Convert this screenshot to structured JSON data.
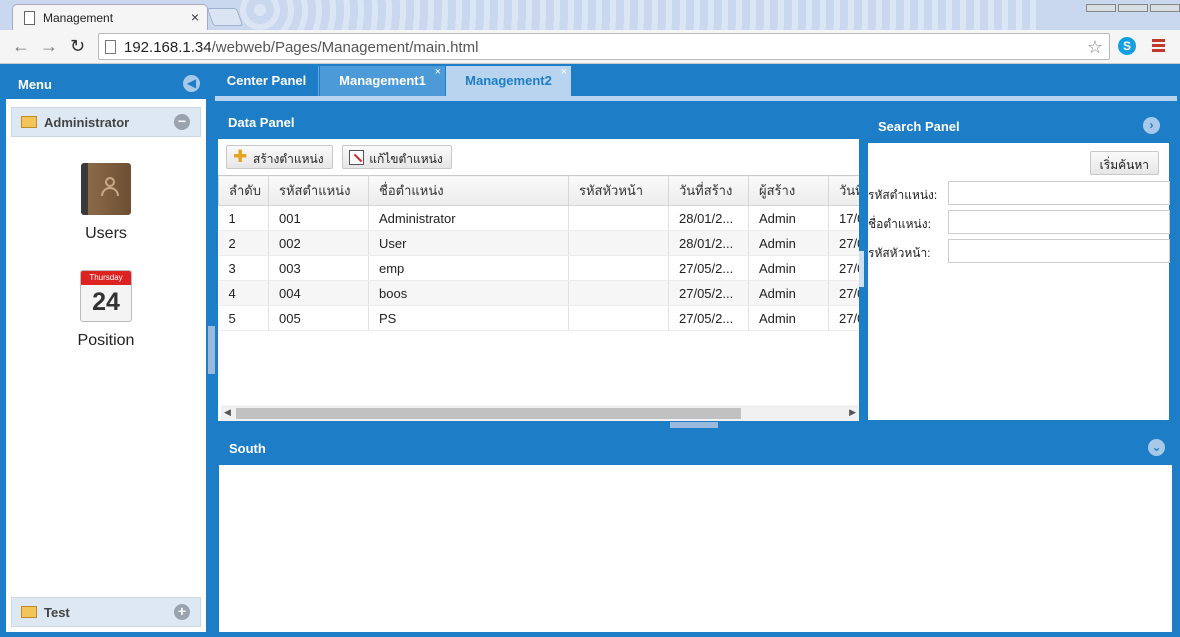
{
  "browser": {
    "tab_title": "Management",
    "tab_close": "×",
    "url_host": "192.168.1.34",
    "url_path": "/webweb/Pages/Management/main.html",
    "skype_letter": "S"
  },
  "west": {
    "title": "Menu",
    "collapse_glyph": "◀",
    "group_admin": {
      "label": "Administrator",
      "toggle": "−"
    },
    "group_test": {
      "label": "Test",
      "toggle": "+"
    },
    "apps": [
      {
        "label": "Users"
      },
      {
        "label": "Position",
        "cal_day_name": "Thursday",
        "cal_day": "24"
      }
    ]
  },
  "tabs": [
    {
      "label": "Center Panel",
      "close": ""
    },
    {
      "label": "Management1",
      "close": "×"
    },
    {
      "label": "Management2",
      "close": "×"
    }
  ],
  "data_panel": {
    "title": "Data Panel",
    "create_button": "สร้างตำแหน่ง",
    "edit_button": "แก้ไขตำแหน่ง",
    "columns": [
      "ลำดับ",
      "รหัสตำแหน่ง",
      "ชื่อตำแหน่ง",
      "รหัสหัวหน้า",
      "วันที่สร้าง",
      "ผู้สร้าง",
      "วันที่"
    ],
    "rows": [
      [
        "1",
        "001",
        "Administrator",
        "",
        "28/01/2...",
        "Admin",
        "17/0"
      ],
      [
        "2",
        "002",
        "User",
        "",
        "28/01/2...",
        "Admin",
        "27/0"
      ],
      [
        "3",
        "003",
        "emp",
        "",
        "27/05/2...",
        "Admin",
        "27/0"
      ],
      [
        "4",
        "004",
        "boos",
        "",
        "27/05/2...",
        "Admin",
        "27/0"
      ],
      [
        "5",
        "005",
        "PS",
        "",
        "27/05/2...",
        "Admin",
        "27/0"
      ]
    ],
    "selected_row": 1
  },
  "search_panel": {
    "title": "Search Panel",
    "search_button": "เริ่มค้นหา",
    "fields": [
      {
        "label": "รหัสตำแหน่ง:",
        "value": ""
      },
      {
        "label": "ชื่อตำแหน่ง:",
        "value": ""
      },
      {
        "label": "รหัสหัวหน้า:",
        "value": ""
      }
    ]
  },
  "south": {
    "title": "South"
  },
  "colors": {
    "accent": "#1d7ec7",
    "selected_row": "#c4dcf0",
    "active_tab": "#b8d4ee"
  }
}
